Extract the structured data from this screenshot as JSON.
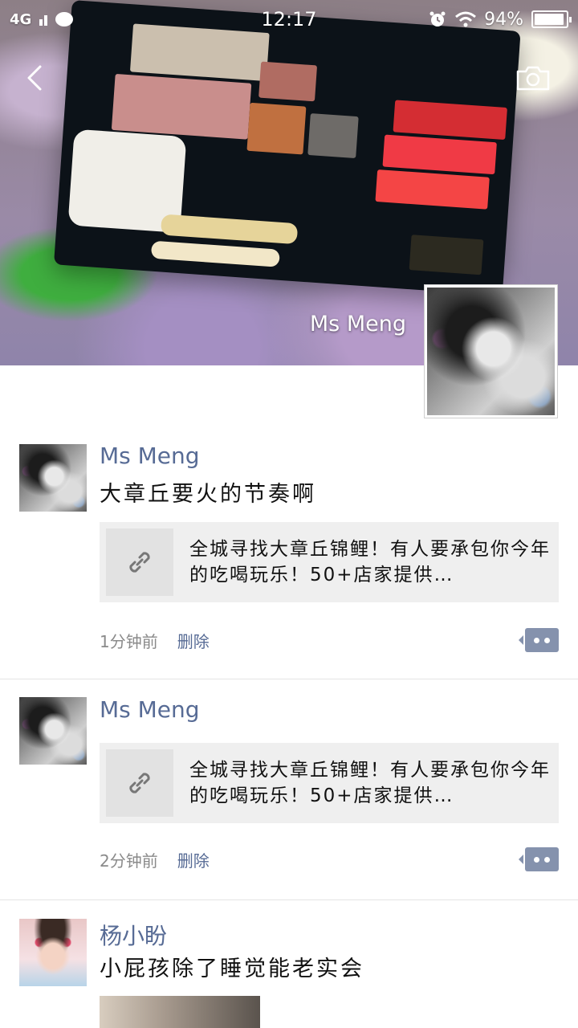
{
  "status_bar": {
    "network": "4G",
    "time": "12:17",
    "battery_level": 0.94,
    "battery_text": "94%"
  },
  "cover": {
    "name": "Ms Meng",
    "back_icon": "chevron-left-icon",
    "camera_icon": "camera-icon"
  },
  "posts": [
    {
      "author": "Ms Meng",
      "text": "大章丘要火的节奏啊",
      "link_title": "全城寻找大章丘锦鲤！有人要承包你今年的吃喝玩乐！50+店家提供…",
      "time": "1分钟前",
      "delete_label": "删除",
      "icon": "link-icon"
    },
    {
      "author": "Ms Meng",
      "text": "",
      "link_title": "全城寻找大章丘锦鲤！有人要承包你今年的吃喝玩乐！50+店家提供…",
      "time": "2分钟前",
      "delete_label": "删除",
      "icon": "link-icon"
    },
    {
      "author": "杨小盼",
      "text": "小屁孩除了睡觉能老实会"
    }
  ],
  "colors": {
    "author": "#576b95",
    "card_bg": "#efefef",
    "comment_button": "#8592ad"
  }
}
